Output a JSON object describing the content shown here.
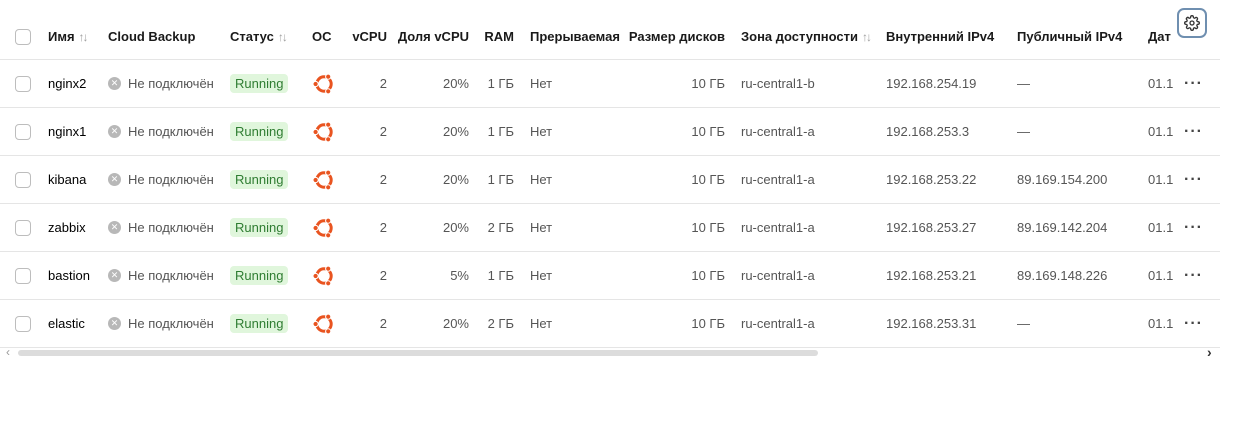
{
  "columns": {
    "name": "Имя",
    "backup": "Cloud Backup",
    "status": "Статус",
    "os": "ОС",
    "vcpu": "vCPU",
    "vcpu_share": "Доля vCPU",
    "ram": "RAM",
    "preemptible": "Прерываемая",
    "disk_size": "Размер дисков",
    "zone": "Зона доступности",
    "internal_ip": "Внутренний IPv4",
    "public_ip": "Публичный IPv4",
    "date": "Дат"
  },
  "colors": {
    "accent": "#6f8fb0",
    "running_bg": "#e0f6dc",
    "running_text": "#2f7d32",
    "ubuntu": "#e95420"
  },
  "icons": {
    "os": "ubuntu-icon",
    "backup": "x-circle-icon",
    "settings": "gear-icon",
    "more": "ellipsis-icon"
  },
  "rows": [
    {
      "name": "nginx2",
      "backup": "Не подключён",
      "status": "Running",
      "vcpu": "2",
      "vcpu_share": "20%",
      "ram": "1 ГБ",
      "preemptible": "Нет",
      "disk_size": "10 ГБ",
      "zone": "ru-central1-b",
      "internal_ip": "192.168.254.19",
      "public_ip": "—",
      "date": "01.1"
    },
    {
      "name": "nginx1",
      "backup": "Не подключён",
      "status": "Running",
      "vcpu": "2",
      "vcpu_share": "20%",
      "ram": "1 ГБ",
      "preemptible": "Нет",
      "disk_size": "10 ГБ",
      "zone": "ru-central1-a",
      "internal_ip": "192.168.253.3",
      "public_ip": "—",
      "date": "01.1"
    },
    {
      "name": "kibana",
      "backup": "Не подключён",
      "status": "Running",
      "vcpu": "2",
      "vcpu_share": "20%",
      "ram": "1 ГБ",
      "preemptible": "Нет",
      "disk_size": "10 ГБ",
      "zone": "ru-central1-a",
      "internal_ip": "192.168.253.22",
      "public_ip": "89.169.154.200",
      "date": "01.1"
    },
    {
      "name": "zabbix",
      "backup": "Не подключён",
      "status": "Running",
      "vcpu": "2",
      "vcpu_share": "20%",
      "ram": "2 ГБ",
      "preemptible": "Нет",
      "disk_size": "10 ГБ",
      "zone": "ru-central1-a",
      "internal_ip": "192.168.253.27",
      "public_ip": "89.169.142.204",
      "date": "01.1"
    },
    {
      "name": "bastion",
      "backup": "Не подключён",
      "status": "Running",
      "vcpu": "2",
      "vcpu_share": "5%",
      "ram": "1 ГБ",
      "preemptible": "Нет",
      "disk_size": "10 ГБ",
      "zone": "ru-central1-a",
      "internal_ip": "192.168.253.21",
      "public_ip": "89.169.148.226",
      "date": "01.1"
    },
    {
      "name": "elastic",
      "backup": "Не подключён",
      "status": "Running",
      "vcpu": "2",
      "vcpu_share": "20%",
      "ram": "2 ГБ",
      "preemptible": "Нет",
      "disk_size": "10 ГБ",
      "zone": "ru-central1-a",
      "internal_ip": "192.168.253.31",
      "public_ip": "—",
      "date": "01.1"
    }
  ]
}
